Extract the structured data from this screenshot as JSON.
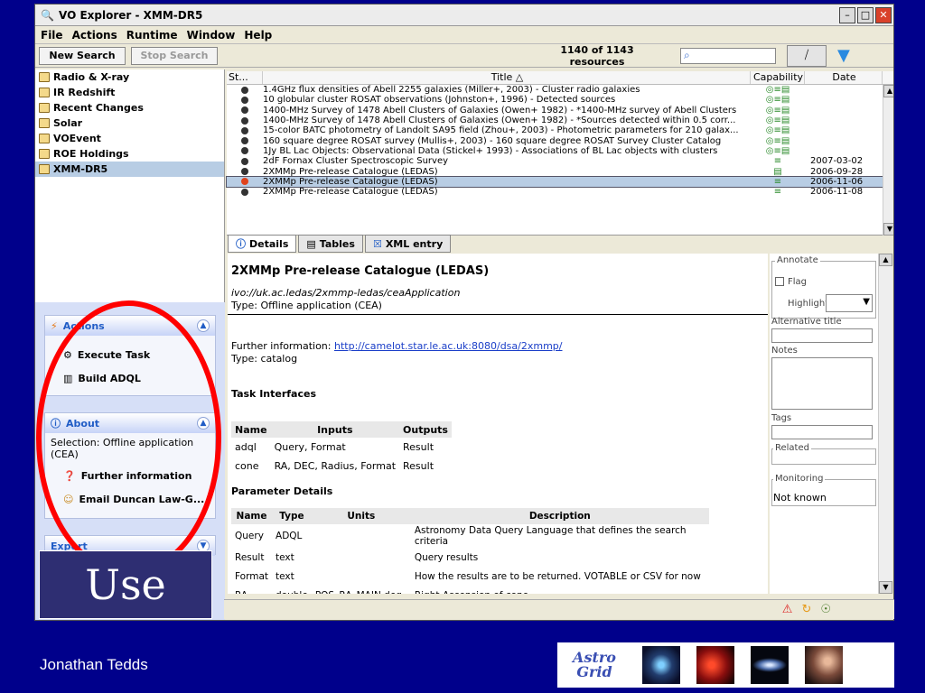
{
  "window": {
    "title": "VO Explorer - XMM-DR5",
    "menu": [
      "File",
      "Actions",
      "Runtime",
      "Window",
      "Help"
    ]
  },
  "toolbar": {
    "new_search": "New Search",
    "stop_search": "Stop Search",
    "resource_count": "1140 of 1143 resources",
    "search_placeholder": ""
  },
  "folders": [
    {
      "label": "Radio & X-ray"
    },
    {
      "label": "IR Redshift"
    },
    {
      "label": "Recent Changes"
    },
    {
      "label": "Solar"
    },
    {
      "label": "VOEvent"
    },
    {
      "label": "ROE Holdings"
    },
    {
      "label": "XMM-DR5",
      "selected": true
    }
  ],
  "actions_panel": {
    "title": "Actions",
    "items": [
      "Execute Task",
      "Build ADQL"
    ]
  },
  "about_panel": {
    "title": "About",
    "selection": "Selection: Offline application (CEA)",
    "items": [
      "Further information",
      "Email Duncan Law-G..."
    ]
  },
  "export_panel": {
    "title": "Export"
  },
  "table": {
    "headers": {
      "status": "St...",
      "title": "Title",
      "capability": "Capability",
      "date": "Date"
    },
    "rows": [
      {
        "title": "1.4GHz flux densities of Abell 2255 galaxies (Miller+, 2003) - Cluster radio galaxies",
        "date": ""
      },
      {
        "title": "10 globular cluster ROSAT observations (Johnston+, 1996) - Detected sources",
        "date": ""
      },
      {
        "title": "1400-MHz Survey of 1478 Abell Clusters of Galaxies (Owen+ 1982) - *1400-MHz survey of Abell Clusters",
        "date": ""
      },
      {
        "title": "1400-MHz Survey of 1478 Abell Clusters of Galaxies (Owen+ 1982) - *Sources detected within 0.5 corr...",
        "date": ""
      },
      {
        "title": "15-color BATC photometry of Landolt SA95 field (Zhou+, 2003) - Photometric parameters for 210 galax...",
        "date": ""
      },
      {
        "title": "160 square degree ROSAT survey (Mullis+, 2003) - 160 square degree ROSAT Survey Cluster Catalog",
        "date": ""
      },
      {
        "title": "1Jy BL Lac Objects: Observational Data (Stickel+ 1993) - Associations of BL Lac objects with clusters",
        "date": ""
      },
      {
        "title": "2dF Fornax Cluster Spectroscopic Survey",
        "date": "2007-03-02"
      },
      {
        "title": "2XMMp Pre-release Catalogue (LEDAS)",
        "date": "2006-09-28"
      },
      {
        "title": "2XMMp Pre-release Catalogue (LEDAS)",
        "date": "2006-11-06",
        "selected": true
      },
      {
        "title": "2XMMp Pre-release Catalogue (LEDAS)",
        "date": "2006-11-08"
      }
    ]
  },
  "tabs": [
    "Details",
    "Tables",
    "XML entry"
  ],
  "details": {
    "title": "2XMMp Pre-release Catalogue (LEDAS)",
    "ivo": "ivo://uk.ac.ledas/2xmmp-ledas/ceaApplication",
    "type1": "Type: Offline application (CEA)",
    "further_label": "Further information: ",
    "further_link": "http://camelot.star.le.ac.uk:8080/dsa/2xmmp/",
    "type2": "Type: catalog",
    "task_interfaces_title": "Task Interfaces",
    "ti_headers": [
      "Name",
      "Inputs",
      "Outputs"
    ],
    "ti_rows": [
      [
        "adql",
        "Query, Format",
        "Result"
      ],
      [
        "cone",
        "RA, DEC, Radius, Format",
        "Result"
      ]
    ],
    "param_title": "Parameter Details",
    "pd_headers": [
      "Name",
      "Type",
      "Units",
      "Description"
    ],
    "pd_rows": [
      [
        "Query",
        "ADQL",
        "",
        "Astronomy Data Query Language that defines the search criteria"
      ],
      [
        "Result",
        "text",
        "",
        "Query results"
      ],
      [
        "Format",
        "text",
        "",
        "How the results are to be returned. VOTABLE or CSV for now"
      ],
      [
        "RA",
        "double",
        "POS_RA_MAIN deg",
        "Right-Ascension of cone"
      ]
    ]
  },
  "annotate": {
    "title": "Annotate",
    "flag": "Flag",
    "highlight": "Highlight",
    "alt_title": "Alternative title",
    "notes": "Notes",
    "tags": "Tags",
    "related": "Related",
    "monitoring": "Monitoring",
    "monitoring_value": "Not known"
  },
  "slide": {
    "use_label": "Use",
    "author": "Jonathan Tedds",
    "logo_line1": "Astro",
    "logo_line2": "Grid"
  }
}
